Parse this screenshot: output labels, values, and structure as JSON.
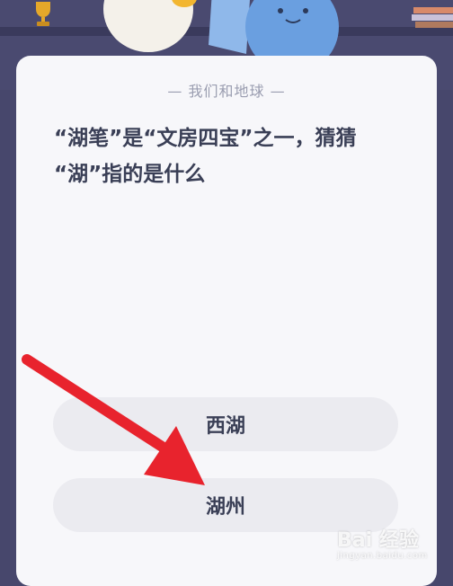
{
  "topic": "— 我们和地球 —",
  "question": {
    "line1": "“湖笔”是“文房四宝”之一，猜猜",
    "line2": "“湖”指的是什么"
  },
  "options": [
    {
      "label": "西湖"
    },
    {
      "label": "湖州"
    }
  ],
  "watermark": {
    "brand": "Bai 经验",
    "url": "jingyan.baidu.com"
  },
  "colors": {
    "background": "#47476c",
    "card": "#f7f7fa",
    "option": "#ebebf0",
    "text": "#3a3f56",
    "arrow": "#e8232d"
  }
}
